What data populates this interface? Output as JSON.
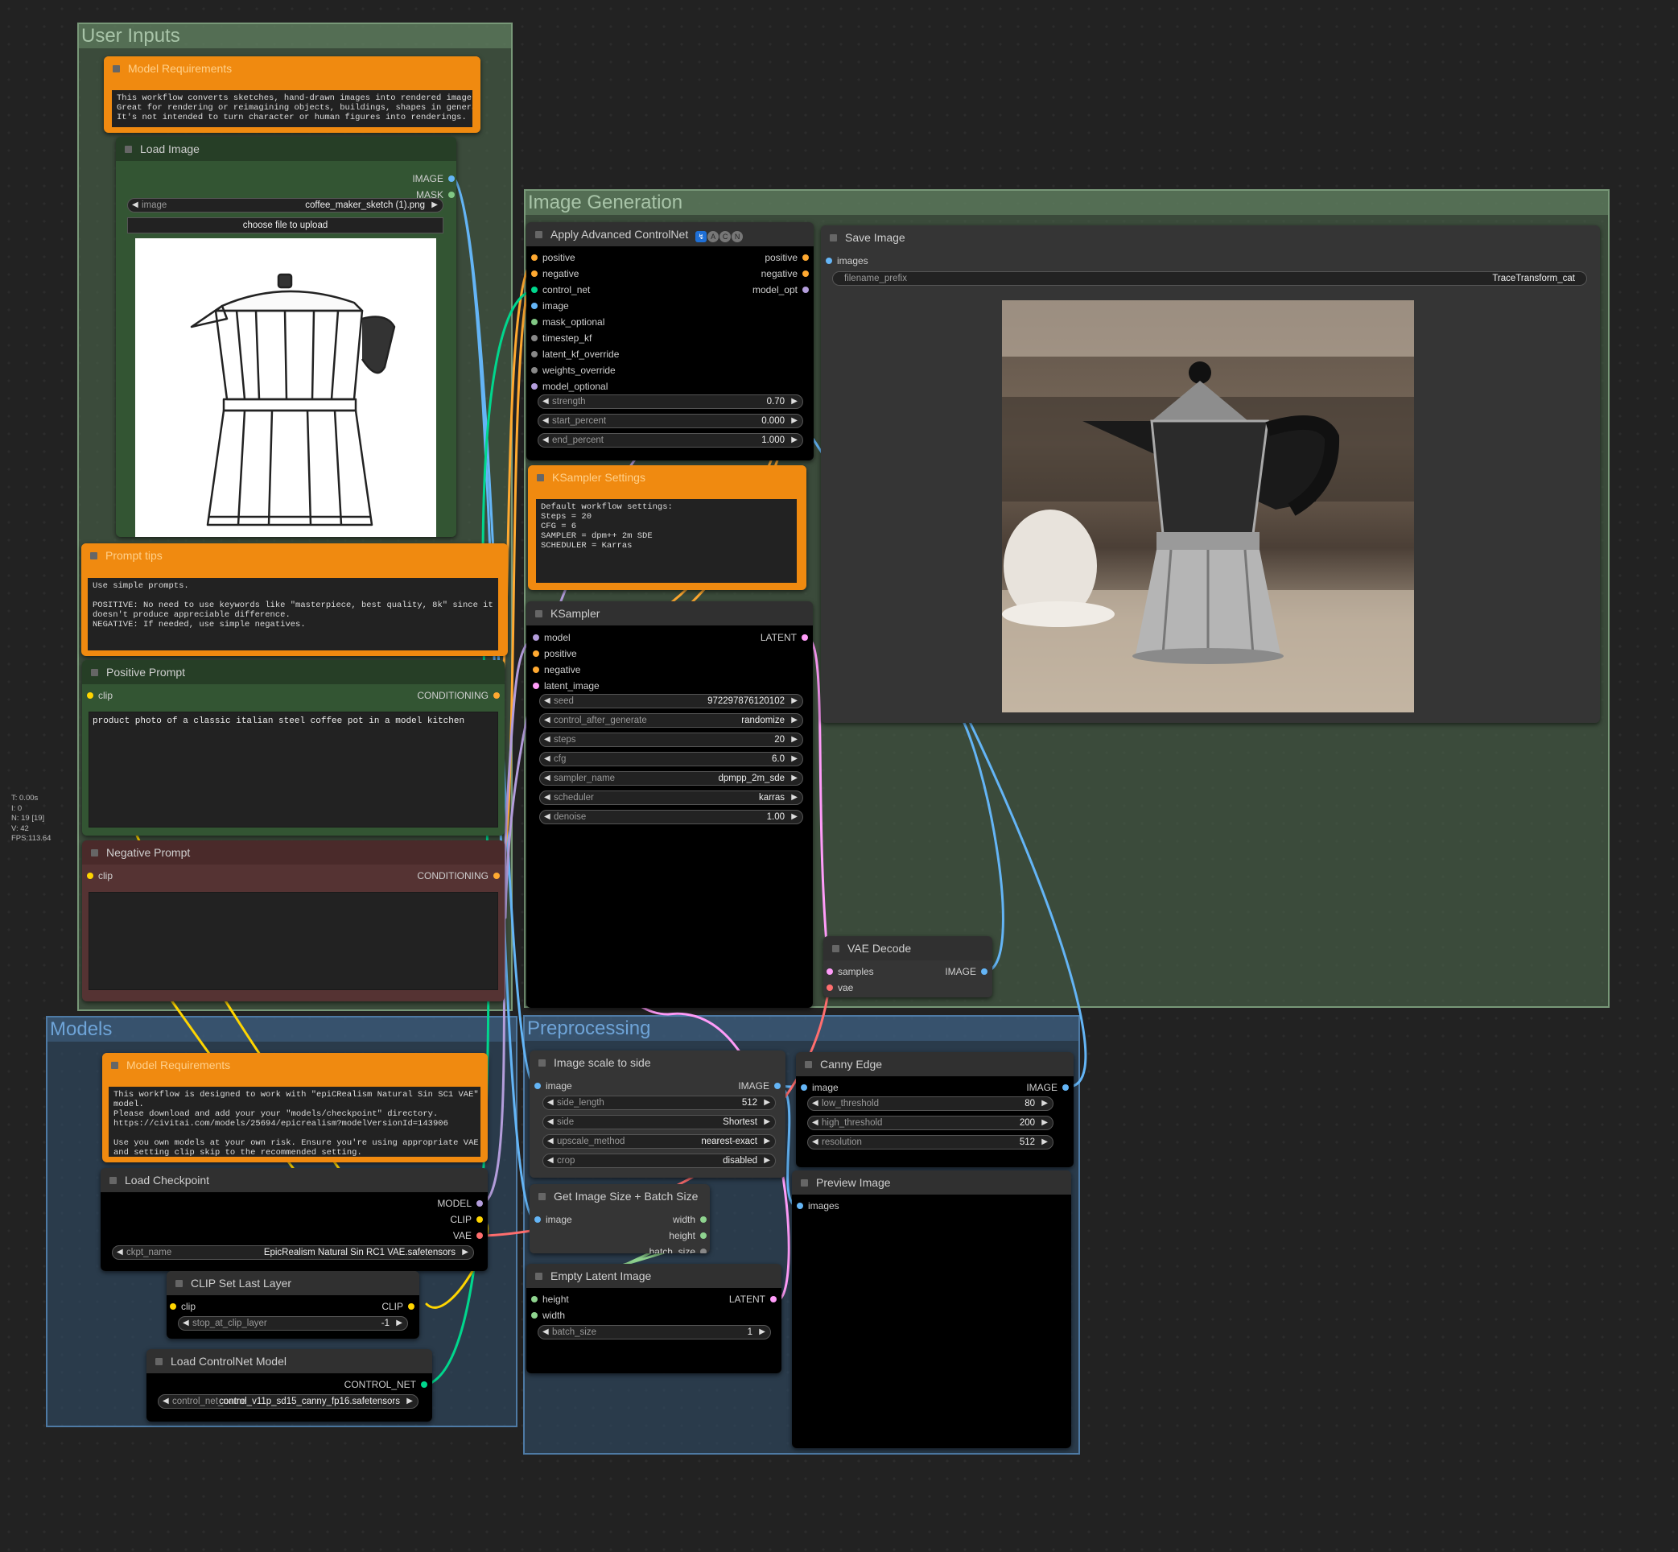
{
  "groups": {
    "user_inputs": "User Inputs",
    "image_generation": "Image Generation",
    "models": "Models",
    "preprocessing": "Preprocessing"
  },
  "stats": {
    "t": "T: 0.00s",
    "i": "I: 0",
    "n": "N: 19 [19]",
    "v": "V: 42",
    "fps": "FPS:113.64"
  },
  "nodes": {
    "model_req_1": {
      "title": "Model Requirements",
      "text": "This workflow converts sketches, hand-drawn images into rendered images.\nGreat for rendering or reimagining objects, buildings, shapes in general.\nIt's not intended to turn character or human figures into renderings."
    },
    "load_image": {
      "title": "Load Image",
      "out_image": "IMAGE",
      "out_mask": "MASK",
      "image_label": "image",
      "image_value": "coffee_maker_sketch (1).png",
      "upload": "choose file to upload"
    },
    "prompt_tips": {
      "title": "Prompt tips",
      "text": "Use simple prompts.\n\nPOSITIVE: No need to use keywords like \"masterpiece, best quality, 8k\" since it\ndoesn't produce appreciable difference.\nNEGATIVE: If needed, use simple negatives."
    },
    "positive_prompt": {
      "title": "Positive Prompt",
      "in_clip": "clip",
      "out": "CONDITIONING",
      "text": "product photo of a classic italian steel coffee pot in a model kitchen"
    },
    "negative_prompt": {
      "title": "Negative Prompt",
      "in_clip": "clip",
      "out": "CONDITIONING",
      "text": ""
    },
    "controlnet": {
      "title": "Apply Advanced ControlNet",
      "inputs": [
        "positive",
        "negative",
        "control_net",
        "image",
        "mask_optional",
        "timestep_kf",
        "latent_kf_override",
        "weights_override",
        "model_optional"
      ],
      "outputs": [
        "positive",
        "negative",
        "model_opt"
      ],
      "widgets": [
        {
          "label": "strength",
          "value": "0.70"
        },
        {
          "label": "start_percent",
          "value": "0.000"
        },
        {
          "label": "end_percent",
          "value": "1.000"
        }
      ]
    },
    "ksampler_settings": {
      "title": "KSampler Settings",
      "text": "Default workflow settings:\nSteps = 20\nCFG = 6\nSAMPLER = dpm++ 2m SDE\nSCHEDULER = Karras"
    },
    "ksampler": {
      "title": "KSampler",
      "inputs": [
        "model",
        "positive",
        "negative",
        "latent_image"
      ],
      "output": "LATENT",
      "widgets": [
        {
          "label": "seed",
          "value": "972297876120102"
        },
        {
          "label": "control_after_generate",
          "value": "randomize"
        },
        {
          "label": "steps",
          "value": "20"
        },
        {
          "label": "cfg",
          "value": "6.0"
        },
        {
          "label": "sampler_name",
          "value": "dpmpp_2m_sde"
        },
        {
          "label": "scheduler",
          "value": "karras"
        },
        {
          "label": "denoise",
          "value": "1.00"
        }
      ]
    },
    "save_image": {
      "title": "Save Image",
      "in_images": "images",
      "prefix_label": "filename_prefix",
      "prefix_value": "TraceTransform_cat"
    },
    "vae_decode": {
      "title": "VAE Decode",
      "in_samples": "samples",
      "in_vae": "vae",
      "out": "IMAGE"
    },
    "model_req_2": {
      "title": "Model Requirements",
      "text": "This workflow is designed to work with \"epiCRealism Natural Sin SC1 VAE\"\nmodel.\nPlease download and add your your \"models/checkpoint\" directory.\nhttps://civitai.com/models/25694/epicrealism?modelVersionId=143906\n\nUse you own models at your own risk. Ensure you're using appropriate VAE\nand setting clip skip to the recommended setting."
    },
    "load_checkpoint": {
      "title": "Load Checkpoint",
      "outputs": [
        "MODEL",
        "CLIP",
        "VAE"
      ],
      "ckpt_label": "ckpt_name",
      "ckpt_value": "EpicRealism Natural Sin RC1 VAE.safetensors"
    },
    "clip_set_last": {
      "title": "CLIP Set Last Layer",
      "in_clip": "clip",
      "out": "CLIP",
      "widget_label": "stop_at_clip_layer",
      "widget_value": "-1"
    },
    "load_controlnet": {
      "title": "Load ControlNet Model",
      "out": "CONTROL_NET",
      "widget_label": "control_net_name",
      "widget_value": "control_v11p_sd15_canny_fp16.safetensors"
    },
    "image_scale": {
      "title": "Image scale to side",
      "in_image": "image",
      "out": "IMAGE",
      "widgets": [
        {
          "label": "side_length",
          "value": "512"
        },
        {
          "label": "side",
          "value": "Shortest"
        },
        {
          "label": "upscale_method",
          "value": "nearest-exact"
        },
        {
          "label": "crop",
          "value": "disabled"
        }
      ]
    },
    "canny": {
      "title": "Canny Edge",
      "in_image": "image",
      "out": "IMAGE",
      "widgets": [
        {
          "label": "low_threshold",
          "value": "80"
        },
        {
          "label": "high_threshold",
          "value": "200"
        },
        {
          "label": "resolution",
          "value": "512"
        }
      ]
    },
    "get_size": {
      "title": "Get Image Size + Batch Size",
      "in_image": "image",
      "outputs": [
        "width",
        "height",
        "batch_size"
      ]
    },
    "empty_latent": {
      "title": "Empty Latent Image",
      "inputs": [
        "height",
        "width"
      ],
      "out": "LATENT",
      "widget_label": "batch_size",
      "widget_value": "1"
    },
    "preview_image": {
      "title": "Preview Image",
      "in_images": "images"
    }
  },
  "colors": {
    "image": "#64b5f6",
    "mask": "#81c784",
    "conditioning": "#ffa931",
    "control_net": "#00d78d",
    "latent": "#ff9cf9",
    "model": "#b39ddb",
    "clip": "#ffd500",
    "vae": "#ff6e6e",
    "note": "#f08a10"
  }
}
